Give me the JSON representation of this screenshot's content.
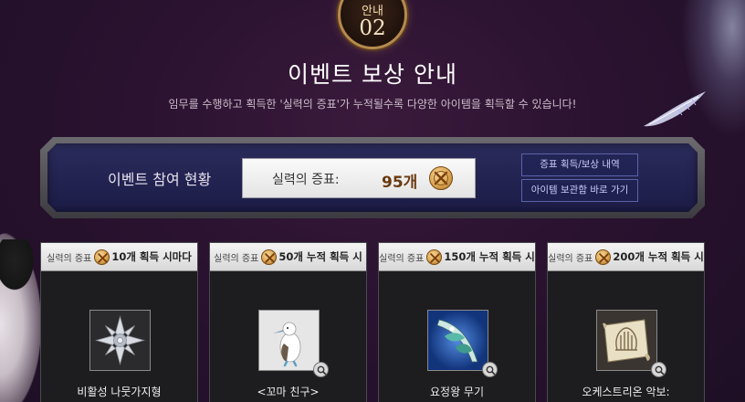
{
  "header": {
    "badge_label": "안내",
    "badge_number": "02",
    "title": "이벤트 보상 안내",
    "subtitle": "임무를 수행하고 획득한 '실력의 증표'가 누적될수록 다양한 아이템을 획득할 수 있습니다!"
  },
  "status": {
    "label": "이벤트 참여 현황",
    "counter_label": "실력의 증표:",
    "counter_value": "95개",
    "buttons": {
      "history": "증표 획득/보상 내역",
      "storage": "아이템 보관함 바로 가기"
    }
  },
  "cards": [
    {
      "prefix": "실력의 증표",
      "condition": "10개 획득 시마다",
      "item": "비활성 나뭇가지형",
      "icon": "silver-cross-emblem-icon"
    },
    {
      "prefix": "실력의 증표",
      "condition": "50개 누적 획득 시",
      "item": "<꼬마 친구>",
      "icon": "booby-bird-icon"
    },
    {
      "prefix": "실력의 증표",
      "condition": "150개 누적 획득 시",
      "item": "요정왕 무기",
      "icon": "fairy-weapon-icon"
    },
    {
      "prefix": "실력의 증표",
      "condition": "200개 누적 획득 시",
      "item": "오케스트리온 악보:",
      "icon": "orchestrion-scroll-icon"
    }
  ],
  "colors": {
    "background": "#2a1230",
    "status_panel": "#24245a",
    "medal_gold": "#d9a653",
    "counter_text": "#6a3a10"
  }
}
